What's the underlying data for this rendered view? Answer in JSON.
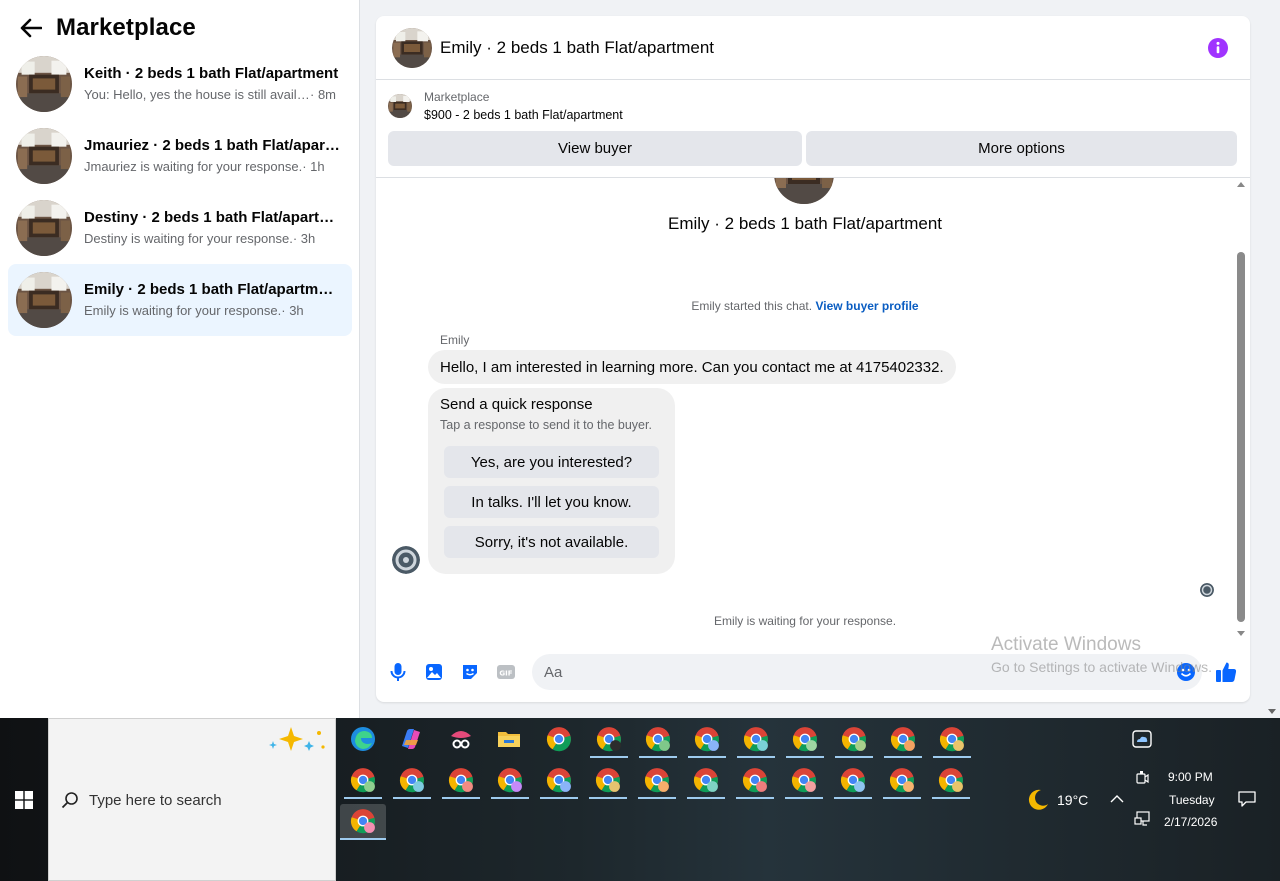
{
  "sidebar": {
    "title": "Marketplace",
    "conversations": [
      {
        "name": "Keith · 2 beds 1 bath Flat/apartment",
        "preview": "You: Hello, yes the house is still availa...",
        "time": " · 8m"
      },
      {
        "name": "Jmauriez · 2 beds 1 bath Flat/apartment",
        "preview": "Jmauriez is waiting for your response.",
        "time": " · 1h"
      },
      {
        "name": "Destiny · 2 beds 1 bath Flat/apartment",
        "preview": "Destiny is waiting for your response.",
        "time": " · 3h"
      },
      {
        "name": "Emily · 2 beds 1 bath Flat/apartment",
        "preview": "Emily is waiting for your response.",
        "time": " · 3h"
      }
    ]
  },
  "chat": {
    "title": "Emily · 2 beds 1 bath Flat/apartment",
    "listing": {
      "label": "Marketplace",
      "price_title": "$900 - 2 beds 1 bath Flat/apartment",
      "view_buyer": "View buyer",
      "more_options": "More options"
    },
    "thread_title": "Emily · 2 beds 1 bath Flat/apartment",
    "started_text": "Emily started this chat.",
    "view_profile": "View buyer profile",
    "sender": "Emily",
    "message": "Hello, I am interested in learning more. Can you contact me at 4175402332.",
    "quick_response": {
      "title": "Send a quick response",
      "subtitle": "Tap a response to send it to the buyer.",
      "options": [
        "Yes, are you interested?",
        "In talks. I'll let you know.",
        "Sorry, it's not available."
      ]
    },
    "waiting_text": "Emily is waiting for your response.",
    "composer_placeholder": "Aa"
  },
  "watermark": {
    "title": "Activate Windows",
    "subtitle": "Go to Settings to activate Windows."
  },
  "taskbar": {
    "search_placeholder": "Type here to search",
    "weather": "19°C",
    "time": "9:00 PM",
    "day": "Tuesday",
    "date": "2/17/2026"
  },
  "colors": {
    "accent": "#0866ff",
    "info_purple": "#a033ff",
    "active_conv": "#ebf5ff",
    "link": "#0a5dc2"
  }
}
